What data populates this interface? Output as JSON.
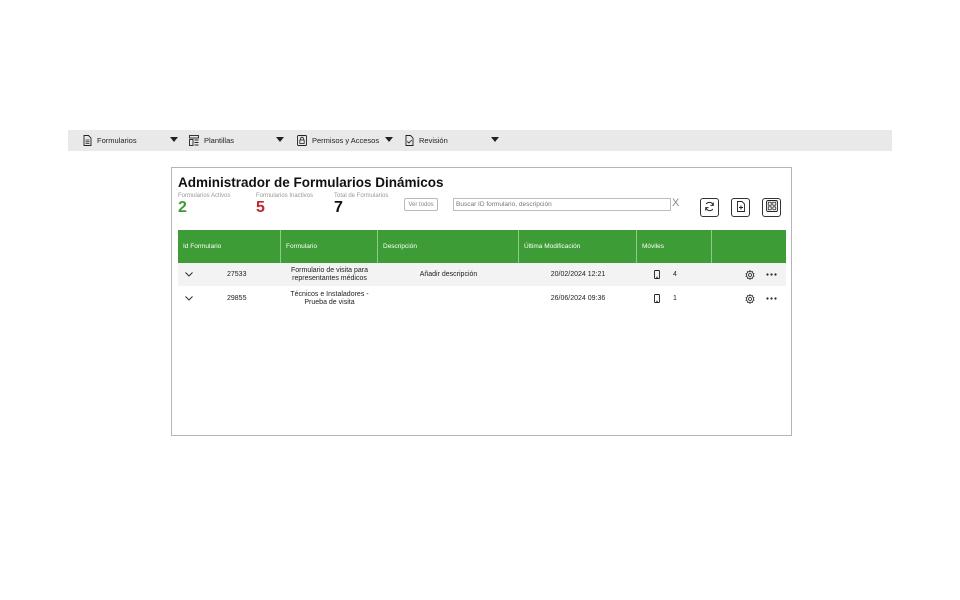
{
  "menu": {
    "items": [
      {
        "label": "Formularios",
        "icon": "document-icon"
      },
      {
        "label": "Plantillas",
        "icon": "template-icon"
      },
      {
        "label": "Permisos y Accesos",
        "icon": "lock-icon"
      },
      {
        "label": "Revisión",
        "icon": "review-icon"
      }
    ]
  },
  "page": {
    "title": "Administrador de Formularios Dinámicos"
  },
  "stats": {
    "active": {
      "label": "Formularios Activos",
      "value": "2",
      "color": "#3d9c35"
    },
    "inactive": {
      "label": "Formularios Inactivos",
      "value": "5",
      "color": "#c0272d"
    },
    "total": {
      "label": "Total de Formularios",
      "value": "7",
      "color": "#111111"
    }
  },
  "toolbar": {
    "ver_todos_label": "Ver todos",
    "search_placeholder": "Buscar ID formulario, descripción",
    "clear_label": "X"
  },
  "table": {
    "header_color": "#3d9c35",
    "columns": [
      "Id Formulario",
      "Formulario",
      "Descripción",
      "Última Modificación",
      "Móviles"
    ],
    "rows": [
      {
        "id": "27533",
        "form_line1": "Formulario de visita para",
        "form_line2": "representantes médicos",
        "description": "Añadir descripción",
        "modified": "20/02/2024 12:21",
        "mobiles": "4"
      },
      {
        "id": "29855",
        "form_line1": "Técnicos e Instaladores -",
        "form_line2": "Prueba de visita",
        "description": "",
        "modified": "26/06/2024 09:36",
        "mobiles": "1"
      }
    ]
  }
}
